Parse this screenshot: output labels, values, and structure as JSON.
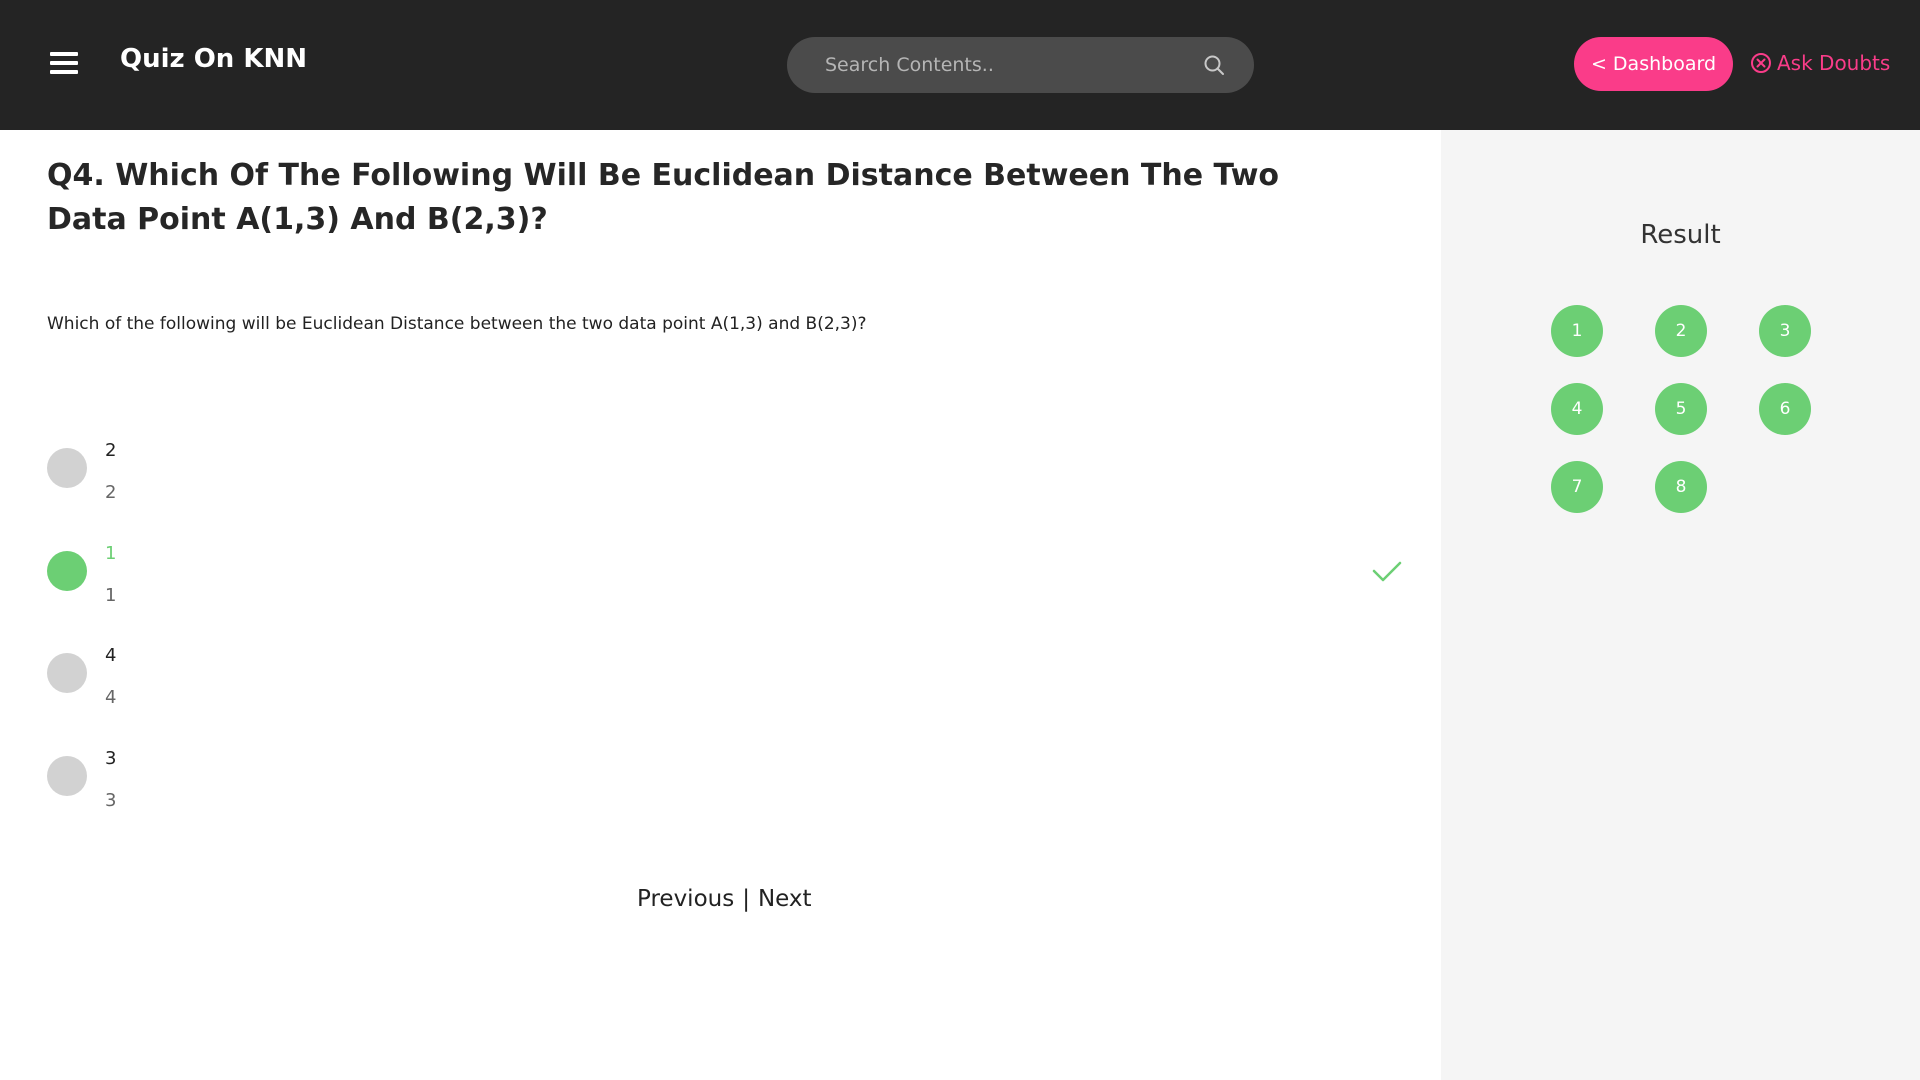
{
  "header": {
    "title": "Quiz On KNN",
    "search_placeholder": "Search Contents..",
    "dashboard_label": "< Dashboard",
    "ask_doubts_label": "Ask Doubts"
  },
  "question": {
    "title": "Q4. Which Of The Following Will Be Euclidean Distance Between The Two Data Point A(1,3) And B(2,3)?",
    "text": "Which of the following will be Euclidean Distance between the two data point A(1,3) and B(2,3)?",
    "options": [
      {
        "label": "2",
        "sub": "2",
        "selected": false,
        "correct": false
      },
      {
        "label": "1",
        "sub": "1",
        "selected": true,
        "correct": true
      },
      {
        "label": "4",
        "sub": "4",
        "selected": false,
        "correct": false
      },
      {
        "label": "3",
        "sub": "3",
        "selected": false,
        "correct": false
      }
    ]
  },
  "pager": {
    "previous": "Previous",
    "separator": "|",
    "next": "Next"
  },
  "sidebar": {
    "title": "Result",
    "items": [
      "1",
      "2",
      "3",
      "4",
      "5",
      "6",
      "7",
      "8"
    ]
  },
  "colors": {
    "topbar": "#242424",
    "accent": "#fa3c89",
    "correct": "#6ccf74",
    "unselected": "#d2d2d2",
    "sidebar_bg": "#f5f5f5"
  }
}
